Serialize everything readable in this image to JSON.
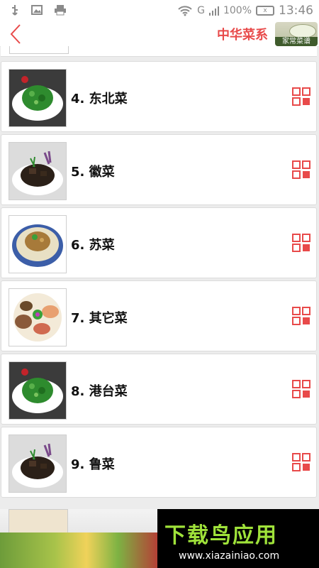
{
  "status_bar": {
    "left_icons": [
      "usb-icon",
      "image-icon",
      "printer-icon"
    ],
    "signal_label": "G",
    "battery_percent": "100%",
    "battery_glyph": "x",
    "time": "13:46"
  },
  "header": {
    "title": "中华菜系",
    "logo_text": "家常菜谱"
  },
  "items": [
    {
      "label": "4. 东北菜",
      "dish": "green-salad"
    },
    {
      "label": "5. 徽菜",
      "dish": "dark-braise"
    },
    {
      "label": "6. 苏菜",
      "dish": "stew-bowl"
    },
    {
      "label": "7. 其它菜",
      "dish": "platter"
    },
    {
      "label": "8. 港台菜",
      "dish": "green-salad"
    },
    {
      "label": "9. 鲁菜",
      "dish": "dark-braise"
    }
  ],
  "ad": {
    "brand": "下载鸟应用",
    "url": "www.xiazainiao.com"
  },
  "colors": {
    "accent": "#e84a4a",
    "icon_red": "#e84a4a",
    "background": "#ececec"
  }
}
